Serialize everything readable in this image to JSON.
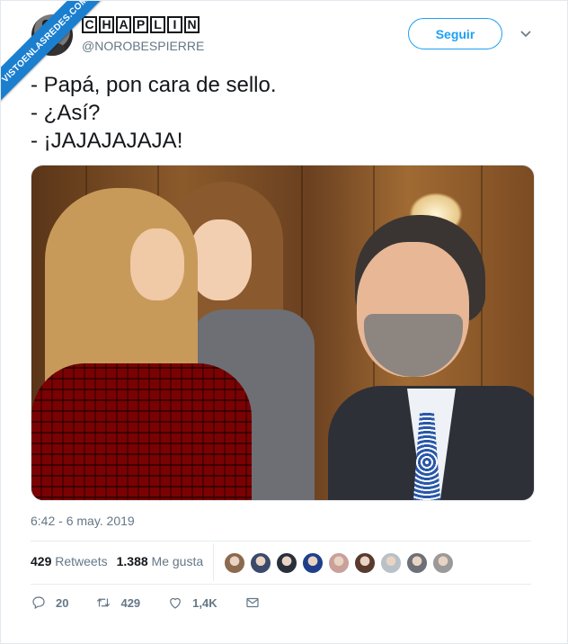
{
  "watermark": {
    "text": "VISTOENLASREDES.COM"
  },
  "author": {
    "display_name_letters": [
      "C",
      "H",
      "A",
      "P",
      "L",
      "I",
      "N"
    ],
    "handle": "@NOROBESPIERRE",
    "avatar_icon": "portrait-avatar"
  },
  "follow_button": {
    "label": "Seguir",
    "color": "#1da1f2"
  },
  "menu_icon": "chevron-down-icon",
  "tweet": {
    "lines": [
      "- Papá, pon cara de sello.",
      "- ¿Así?",
      "- ¡JAJAJAJAJA!"
    ]
  },
  "media": {
    "description_icon": "photo"
  },
  "timestamp": "6:42 - 6 may. 2019",
  "stats": {
    "retweets_count": "429",
    "retweets_label": "Retweets",
    "likes_count": "1.388",
    "likes_label": "Me gusta"
  },
  "liker_colors": [
    "#8b6a4e",
    "#3b4a6b",
    "#2a2f3c",
    "#1f3f8a",
    "#c9a19a",
    "#5a3a2e",
    "#b8c0c8",
    "#6d7077",
    "#9a9a9a"
  ],
  "actions": {
    "reply_count": "20",
    "retweet_count": "429",
    "like_count": "1,4K",
    "icon_color": "#657786"
  }
}
